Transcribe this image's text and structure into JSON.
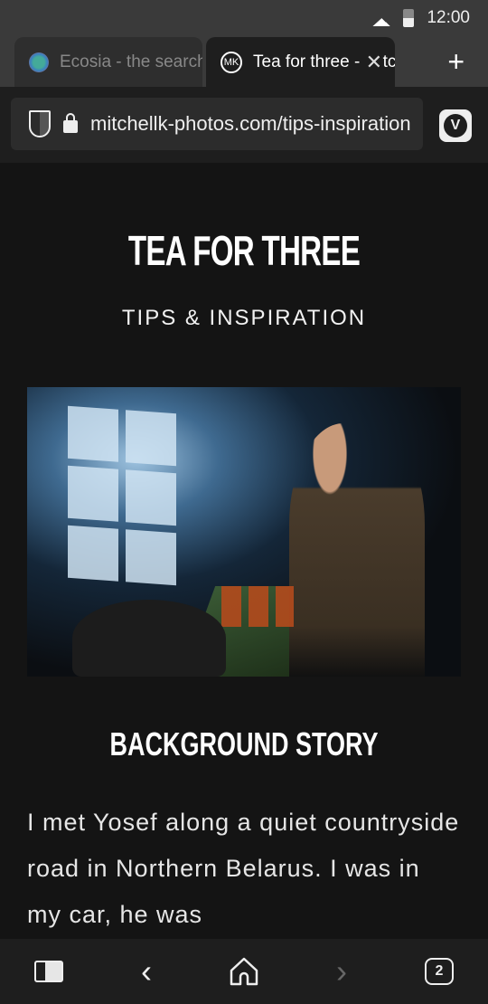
{
  "status": {
    "time": "12:00"
  },
  "tabs": [
    {
      "label": "Ecosia - the search",
      "icon": "ecosia-globe-icon"
    },
    {
      "label": "Tea for three - Mitchell",
      "icon": "mk-logo-icon",
      "active": true
    }
  ],
  "address": {
    "url": "mitchellk-photos.com/tips-inspiration"
  },
  "page": {
    "title": "TEA FOR THREE",
    "subtitle": "TIPS & INSPIRATION",
    "section_heading": "BACKGROUND STORY",
    "body": "I met Yosef along a quiet countryside road in Northern Belarus. I was in my car, he was"
  },
  "bottom_bar": {
    "tab_count": "2",
    "forward_enabled": false
  }
}
